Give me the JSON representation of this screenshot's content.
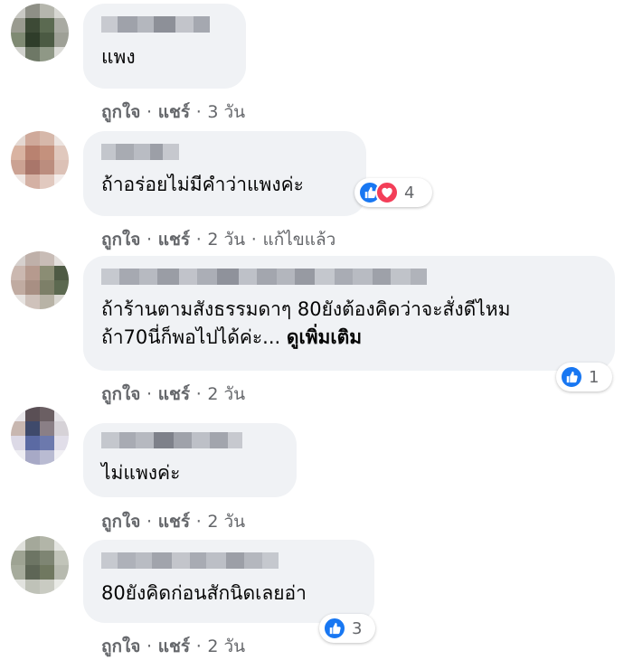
{
  "colors": {
    "bubble": "#f0f2f5",
    "action_text": "#65676b",
    "like_blue": "#1877f2",
    "love_red": "#f33e58"
  },
  "actions": {
    "like": "ถูกใจ",
    "share": "แชร์",
    "sep": "·"
  },
  "comments": [
    {
      "text": "แพง",
      "time": "3 วัน"
    },
    {
      "text": "ถ้าอร่อยไม่มีคำว่าแพงค่ะ",
      "time": "2 วัน",
      "edited": "แก้ไขแล้ว",
      "reaction_count": "4",
      "reaction_icons": [
        "like-icon",
        "love-icon"
      ]
    },
    {
      "text_line1": "ถ้าร้านตามสังธรรมดาๆ 80ยังต้องคิดว่าจะสั่งดีไหม",
      "text_line2": "ถ้า70นี่ก็พอไปได้ค่ะ...",
      "see_more": "ดูเพิ่มเติม",
      "time": "2 วัน",
      "reaction_count": "1",
      "reaction_icons": [
        "like-icon"
      ]
    },
    {
      "text": "ไม่แพงค่ะ",
      "time": "2 วัน"
    },
    {
      "text": "80ยังคิดก่อนสักนิดเลยอ่า",
      "time": "2 วัน",
      "reaction_count": "3",
      "reaction_icons": [
        "like-icon"
      ]
    }
  ]
}
